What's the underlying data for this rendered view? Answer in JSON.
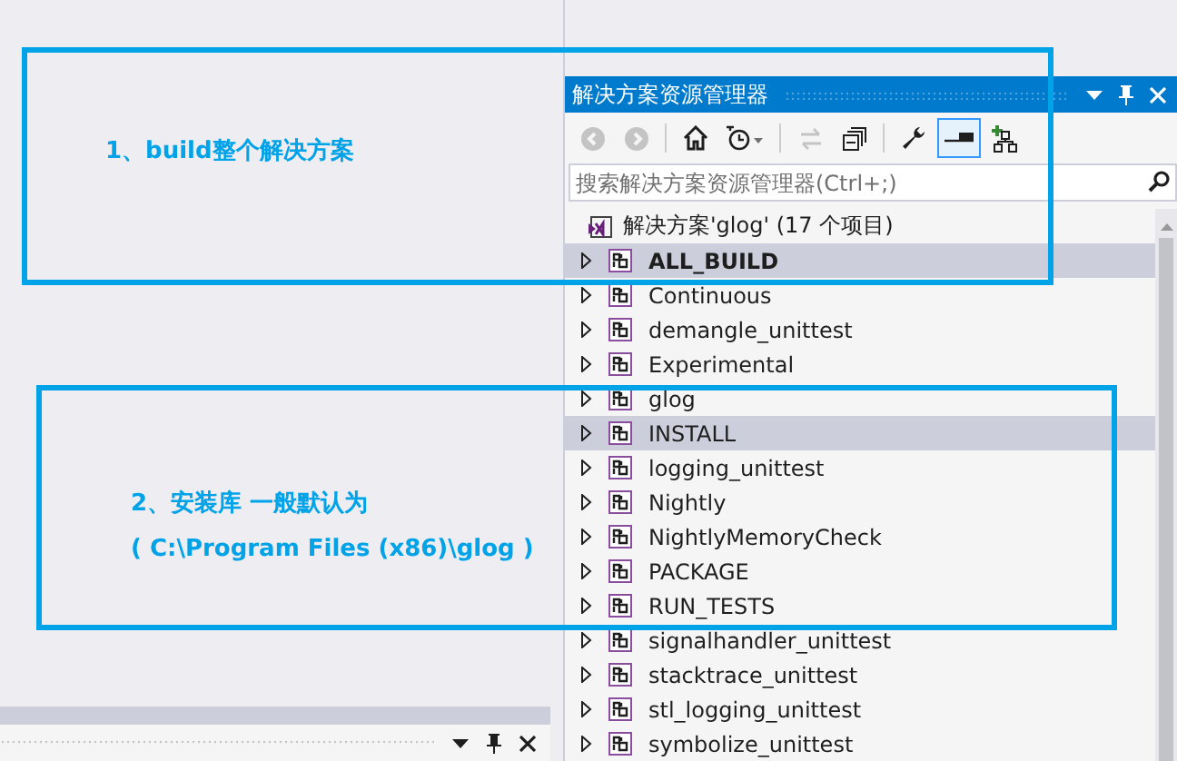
{
  "annotations": [
    {
      "lines": [
        "1、build整个解决方案"
      ]
    },
    {
      "lines": [
        "2、安装库 一般默认为",
        "( C:\\Program Files (x86)\\glog )"
      ]
    }
  ],
  "solution_explorer": {
    "title": "解决方案资源管理器",
    "toolbar": [
      {
        "kind": "back",
        "disabled": true,
        "on": false
      },
      {
        "kind": "forward",
        "disabled": true,
        "on": false
      },
      {
        "kind": "home",
        "disabled": false,
        "on": false
      },
      {
        "kind": "history",
        "disabled": false,
        "on": false
      },
      {
        "kind": "sync",
        "disabled": true,
        "on": false
      },
      {
        "kind": "collapse",
        "disabled": false,
        "on": false
      },
      {
        "kind": "properties",
        "disabled": false,
        "on": false
      },
      {
        "kind": "preview",
        "disabled": false,
        "on": true
      },
      {
        "kind": "new-view",
        "disabled": false,
        "on": false
      }
    ],
    "search": {
      "placeholder": "搜索解决方案资源管理器(Ctrl+;)"
    },
    "solution": "解决方案'glog' (17 个项目)",
    "projects": [
      {
        "name": "ALL_BUILD",
        "selected": true,
        "startup": true
      },
      {
        "name": "Continuous",
        "selected": false,
        "startup": false
      },
      {
        "name": "demangle_unittest",
        "selected": false,
        "startup": false
      },
      {
        "name": "Experimental",
        "selected": false,
        "startup": false
      },
      {
        "name": "glog",
        "selected": false,
        "startup": false
      },
      {
        "name": "INSTALL",
        "selected": true,
        "startup": false
      },
      {
        "name": "logging_unittest",
        "selected": false,
        "startup": false
      },
      {
        "name": "Nightly",
        "selected": false,
        "startup": false
      },
      {
        "name": "NightlyMemoryCheck",
        "selected": false,
        "startup": false
      },
      {
        "name": "PACKAGE",
        "selected": false,
        "startup": false
      },
      {
        "name": "RUN_TESTS",
        "selected": false,
        "startup": false
      },
      {
        "name": "signalhandler_unittest",
        "selected": false,
        "startup": false
      },
      {
        "name": "stacktrace_unittest",
        "selected": false,
        "startup": false
      },
      {
        "name": "stl_logging_unittest",
        "selected": false,
        "startup": false
      },
      {
        "name": "symbolize_unittest",
        "selected": false,
        "startup": false
      }
    ]
  }
}
